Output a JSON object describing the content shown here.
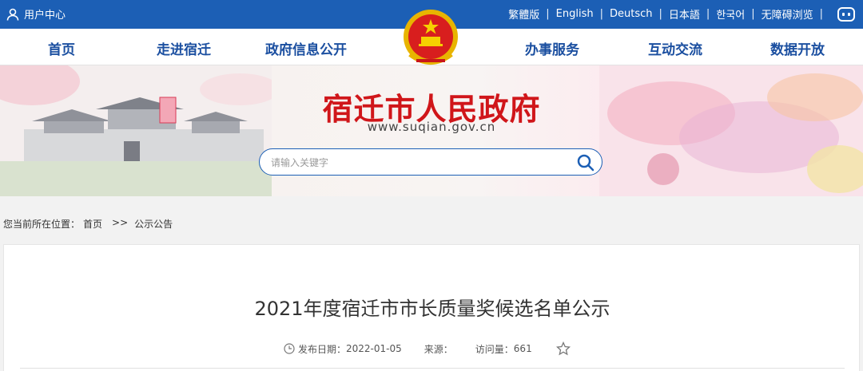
{
  "topbar": {
    "user_center": "用户中心",
    "languages": [
      "繁體版",
      "English",
      "Deutsch",
      "日本語",
      "한국어",
      "无障碍浏览"
    ]
  },
  "nav": {
    "left": [
      "首页",
      "走进宿迁",
      "政府信息公开"
    ],
    "right": [
      "办事服务",
      "互动交流",
      "数据开放"
    ]
  },
  "banner": {
    "title": "宿迁市人民政府",
    "url": "www.suqian.gov.cn",
    "search_placeholder": "请输入关键字"
  },
  "breadcrumb": {
    "prefix": "您当前所在位置：",
    "home": "首页",
    "arrow": ">>",
    "current": "公示公告"
  },
  "article": {
    "title": "2021年度宿迁市市长质量奖候选名单公示",
    "date_label": "发布日期：",
    "date": "2022-01-05",
    "source_label": "来源：",
    "source": "",
    "visits_label": "访问量：",
    "visits": "661"
  },
  "colors": {
    "topbar": "#1c5fb5",
    "nav_text": "#1b4fa0",
    "title_red": "#d0161a"
  },
  "icons": [
    "user-icon",
    "robot-icon",
    "national-emblem",
    "search-icon",
    "clock-icon",
    "star-icon"
  ]
}
